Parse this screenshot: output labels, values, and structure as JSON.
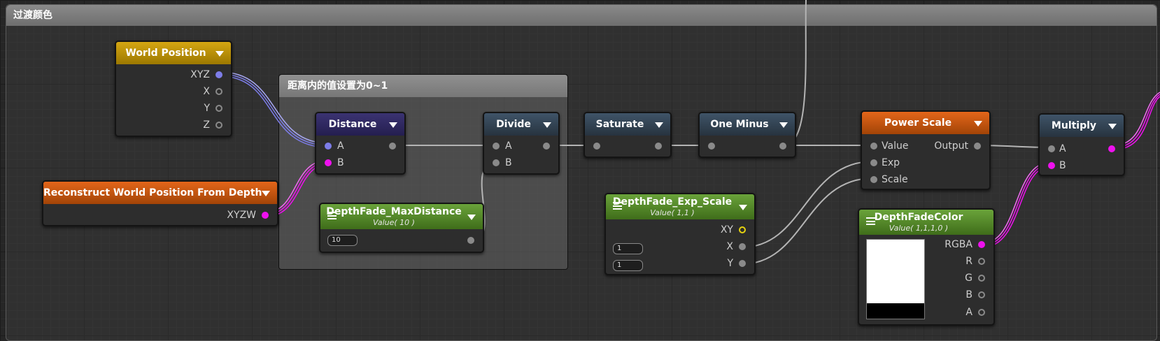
{
  "groups": {
    "main_title": "过渡颜色",
    "inner_title": "距离内的值设置为0~1"
  },
  "nodes": {
    "world_position": {
      "title": "World Position",
      "outputs": [
        "XYZ",
        "X",
        "Y",
        "Z"
      ]
    },
    "reconstruct": {
      "title": "Reconstruct World Position From Depth",
      "outputs": [
        "XYZW"
      ]
    },
    "distance": {
      "title": "Distance",
      "inputs": [
        "A",
        "B"
      ]
    },
    "max_distance": {
      "title": "DepthFade_MaxDistance",
      "subtitle": "Value( 10 )",
      "field_value": "10"
    },
    "divide": {
      "title": "Divide",
      "inputs": [
        "A",
        "B"
      ]
    },
    "saturate": {
      "title": "Saturate"
    },
    "one_minus": {
      "title": "One Minus"
    },
    "exp_scale": {
      "title": "DepthFade_Exp_Scale",
      "subtitle": "Value( 1,1 )",
      "outputs": [
        "XY",
        "X",
        "Y"
      ],
      "field_x": "1",
      "field_y": "1"
    },
    "power_scale": {
      "title": "Power Scale",
      "inputs": [
        "Value",
        "Exp",
        "Scale"
      ],
      "output": "Output"
    },
    "depth_fade_color": {
      "title": "DepthFadeColor",
      "subtitle": "Value( 1,1,1,0 )",
      "outputs": [
        "RGBA",
        "R",
        "G",
        "B",
        "A"
      ]
    },
    "multiply": {
      "title": "Multiply",
      "inputs": [
        "A",
        "B"
      ]
    }
  },
  "colors": {
    "vec3_wire": "#7d7de8",
    "vec4_wire": "#ee11ee",
    "float_wire": "#b4b4b4",
    "vec2_port": "#e6d20f"
  },
  "icons": [
    "dropdown-arrow-icon",
    "menu-icon"
  ]
}
